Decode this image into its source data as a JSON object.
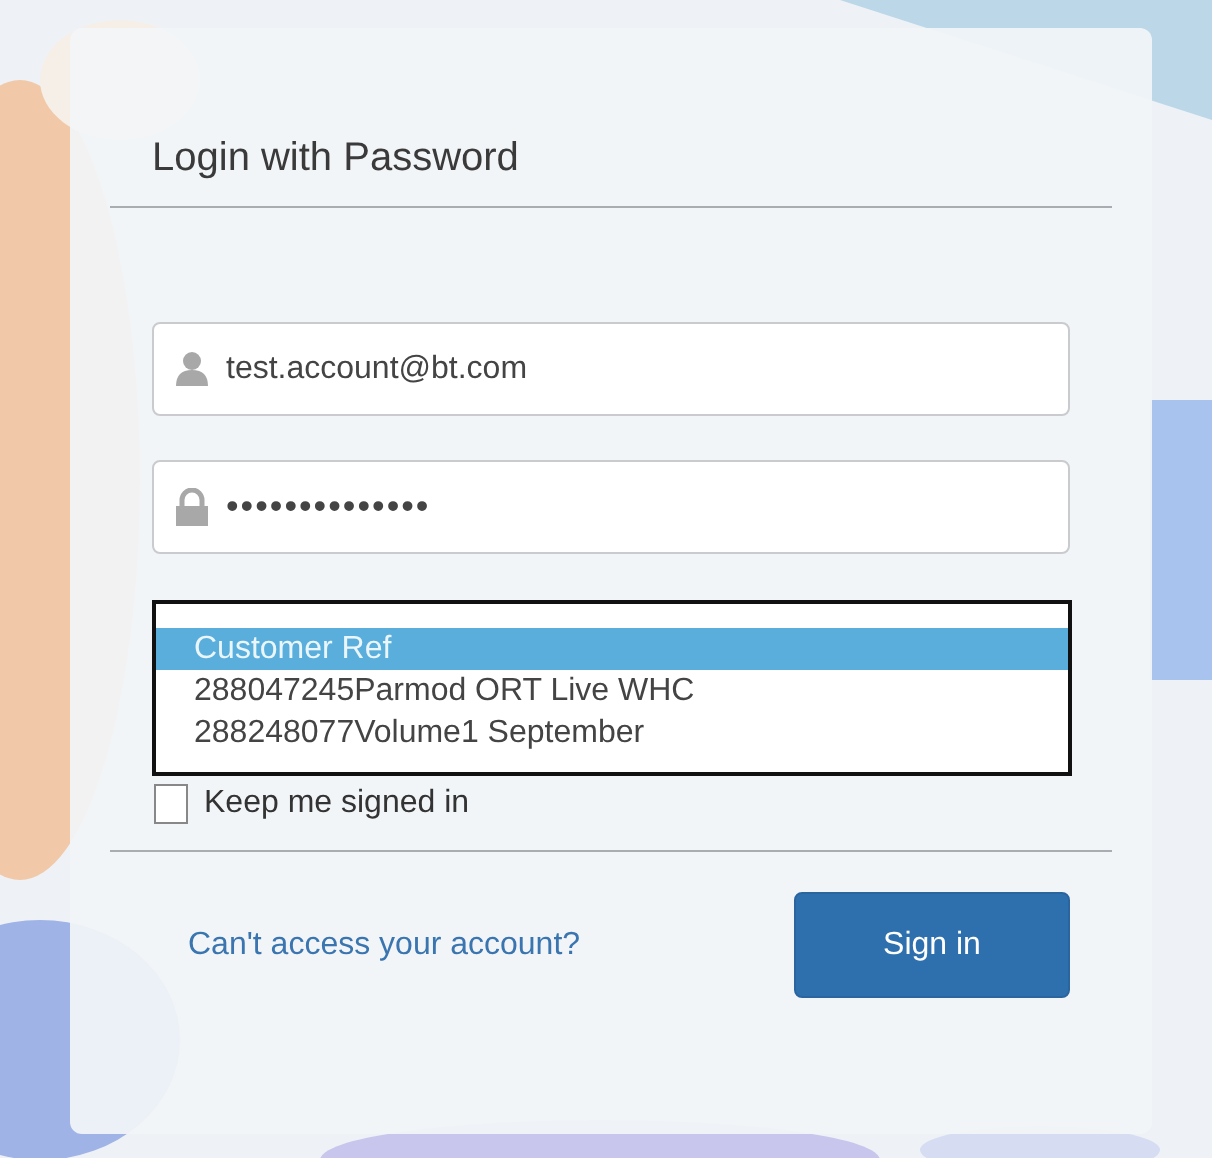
{
  "login_title": "Login with Password",
  "email_field": {
    "value": "test.account@bt.com"
  },
  "password_field": {
    "value": "••••••••••••••"
  },
  "customer_ref_dropdown": {
    "options": [
      {
        "label": "Customer Ref",
        "selected": true
      },
      {
        "label": "288047245Parmod ORT Live WHC",
        "selected": false
      },
      {
        "label": "288248077Volume1 September",
        "selected": false
      }
    ]
  },
  "keep_signed_in": {
    "label": "Keep me signed in",
    "checked": false
  },
  "help_link": "Can't access your account?",
  "sign_in_button": "Sign in"
}
